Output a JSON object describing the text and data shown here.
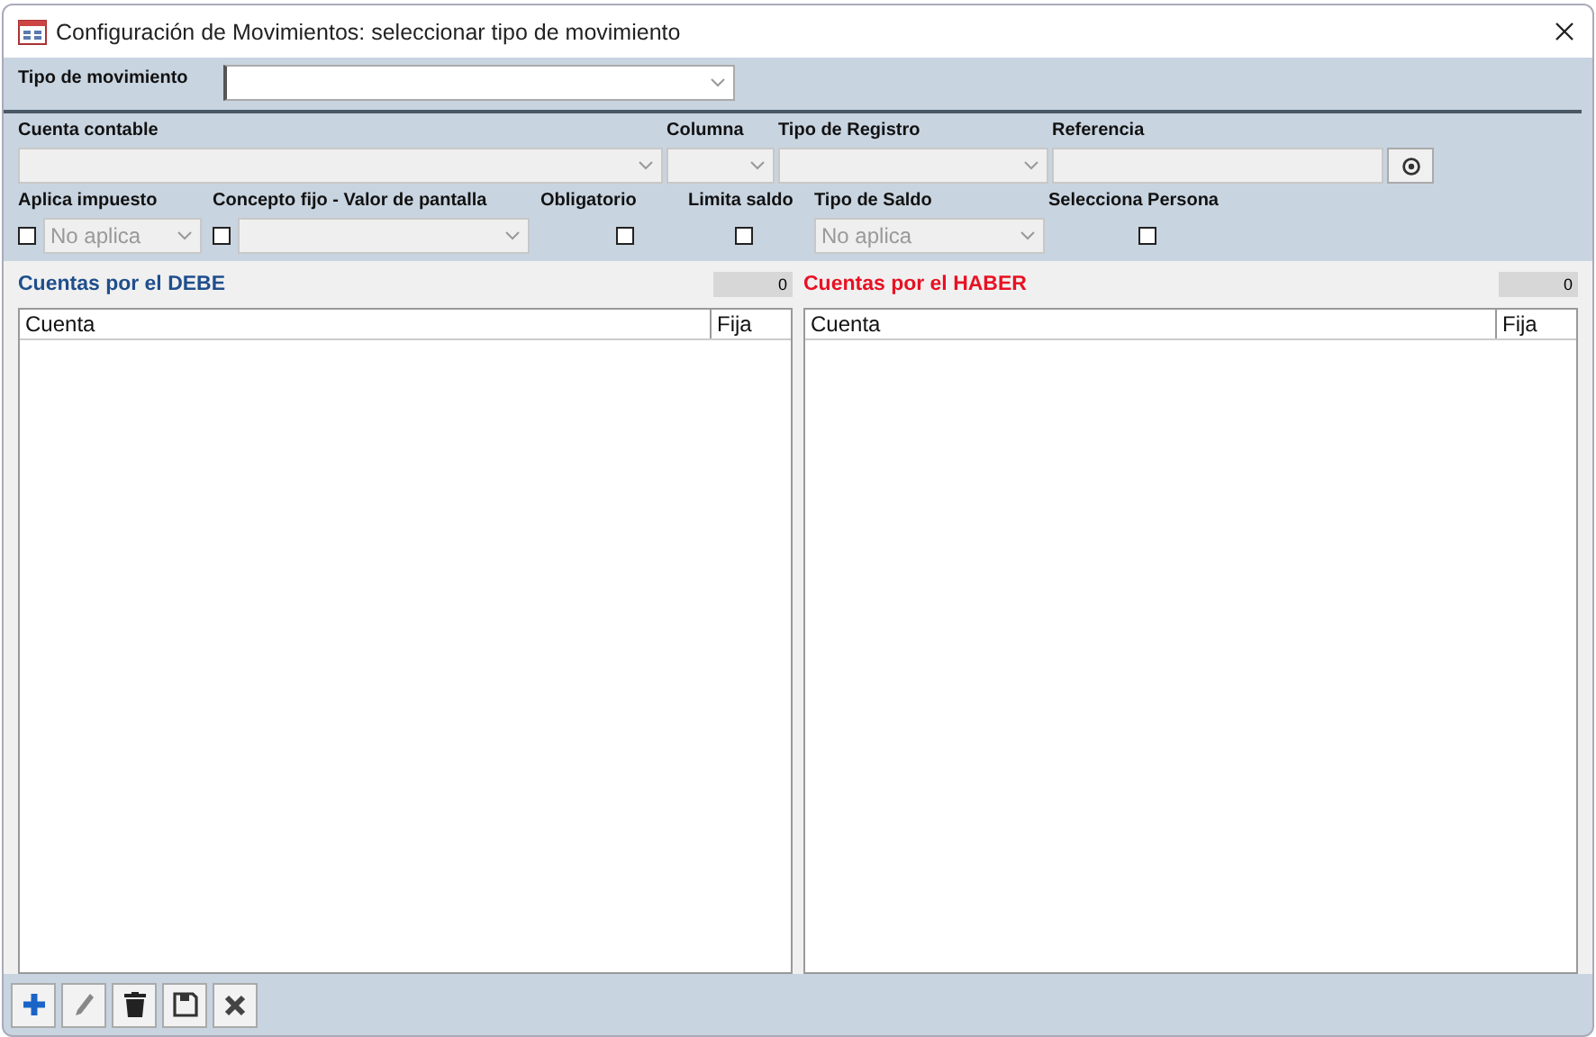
{
  "window": {
    "title": "Configuración de Movimientos: seleccionar tipo de movimiento"
  },
  "tipo_movimiento": {
    "label": "Tipo de movimiento",
    "disabled": false
  },
  "fields": [
    {
      "label": "Cuenta contable",
      "kind": "select",
      "disabled": true
    },
    {
      "label": "Columna",
      "kind": "select",
      "disabled": true
    },
    {
      "label": "Tipo de Registro",
      "kind": "select",
      "disabled": true
    },
    {
      "label": "Referencia",
      "kind": "text",
      "disabled": true
    }
  ],
  "options": [
    {
      "label": "Aplica impuesto",
      "kind": "check-select",
      "checked": false,
      "value": "No aplica"
    },
    {
      "label": "Concepto fijo - Valor de pantalla",
      "kind": "check-select",
      "checked": false
    },
    {
      "label": "Obligatorio",
      "kind": "check",
      "checked": false
    },
    {
      "label": "Limita saldo",
      "kind": "check",
      "checked": false
    },
    {
      "label": "Tipo de Saldo",
      "kind": "select",
      "value": "No aplica"
    },
    {
      "label": "Selecciona Persona",
      "kind": "check",
      "checked": false
    }
  ],
  "lists": [
    {
      "title": "Cuentas por el DEBE",
      "color": "#1f4e8c",
      "count": "0",
      "columns": [
        "Cuenta",
        "Fija"
      ]
    },
    {
      "title": "Cuentas por el HABER",
      "color": "#e81123",
      "count": "0",
      "columns": [
        "Cuenta",
        "Fija"
      ]
    }
  ],
  "toolbar": [
    {
      "kind": "add"
    },
    {
      "kind": "edit"
    },
    {
      "kind": "delete"
    },
    {
      "kind": "save"
    },
    {
      "kind": "cancel"
    }
  ]
}
